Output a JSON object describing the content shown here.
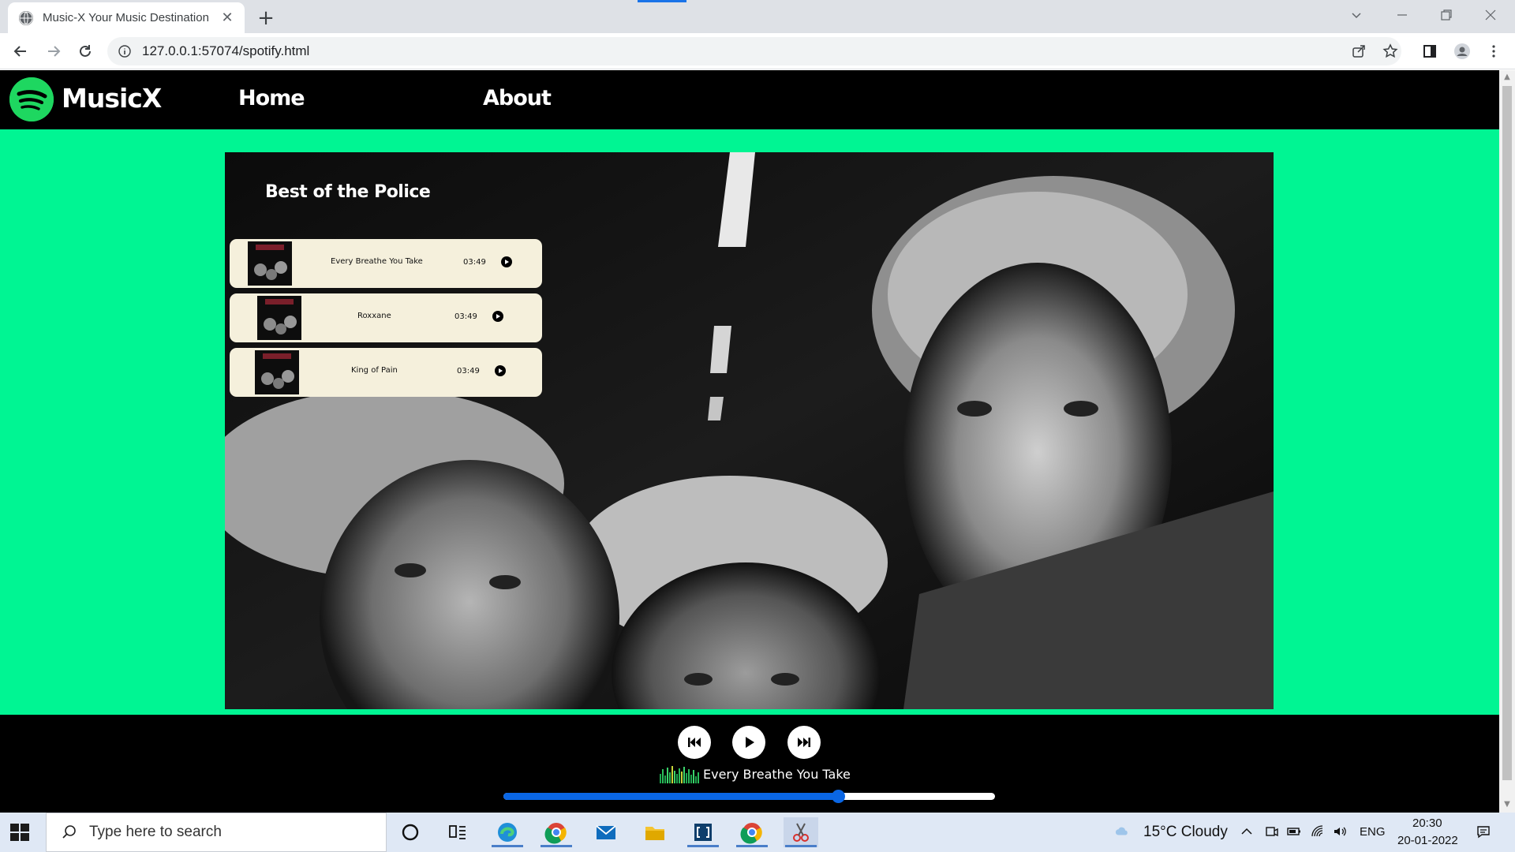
{
  "browser": {
    "tab_title": "Music-X Your Music Destination",
    "tab_close": "✕",
    "new_tab": "+",
    "url": "127.0.0.1:57074/spotify.html"
  },
  "site": {
    "brand": "MusicX",
    "nav": [
      "Home",
      "About"
    ],
    "playlist_title": "Best of the Police",
    "songs": [
      {
        "name": "Every Breathe You Take",
        "duration": "03:49"
      },
      {
        "name": "Roxxane",
        "duration": "03:49"
      },
      {
        "name": "King of Pain",
        "duration": "03:49"
      }
    ],
    "player": {
      "now_playing": "Every Breathe You Take",
      "progress": 0.68,
      "accent": "#0a66e4"
    },
    "colors": {
      "background": "#00f593",
      "nav": "#000000",
      "song_card": "#f5f0dc",
      "logo": "#1ed760"
    }
  },
  "taskbar": {
    "search_placeholder": "Type here to search",
    "weather": "15°C  Cloudy",
    "language": "ENG",
    "time": "20:30",
    "date": "20-01-2022"
  }
}
